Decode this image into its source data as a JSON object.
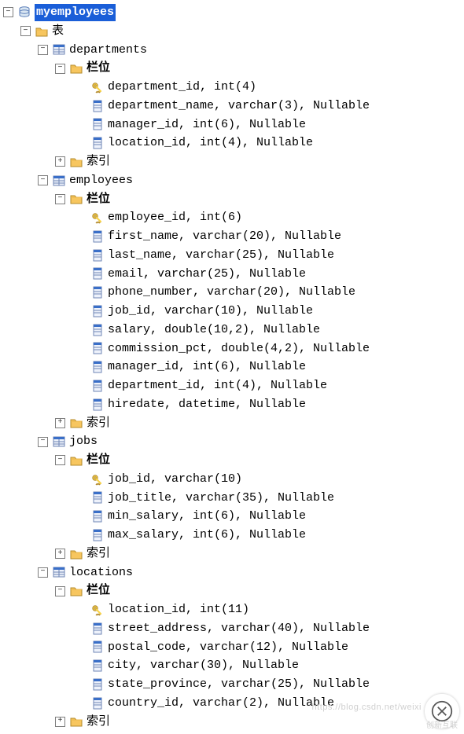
{
  "db": {
    "name": "myemployees"
  },
  "nodes": {
    "tables_label": "表",
    "columns_label": "栏位",
    "indexes_label": "索引"
  },
  "tables": {
    "departments": {
      "name": "departments",
      "columns": [
        {
          "pk": true,
          "text": "department_id, int(4)"
        },
        {
          "pk": false,
          "text": "department_name, varchar(3), Nullable"
        },
        {
          "pk": false,
          "text": "manager_id, int(6), Nullable"
        },
        {
          "pk": false,
          "text": "location_id, int(4), Nullable"
        }
      ]
    },
    "employees": {
      "name": "employees",
      "columns": [
        {
          "pk": true,
          "text": "employee_id, int(6)"
        },
        {
          "pk": false,
          "text": "first_name, varchar(20), Nullable"
        },
        {
          "pk": false,
          "text": "last_name, varchar(25), Nullable"
        },
        {
          "pk": false,
          "text": "email, varchar(25), Nullable"
        },
        {
          "pk": false,
          "text": "phone_number, varchar(20), Nullable"
        },
        {
          "pk": false,
          "text": "job_id, varchar(10), Nullable"
        },
        {
          "pk": false,
          "text": "salary, double(10,2), Nullable"
        },
        {
          "pk": false,
          "text": "commission_pct, double(4,2), Nullable"
        },
        {
          "pk": false,
          "text": "manager_id, int(6), Nullable"
        },
        {
          "pk": false,
          "text": "department_id, int(4), Nullable"
        },
        {
          "pk": false,
          "text": "hiredate, datetime, Nullable"
        }
      ]
    },
    "jobs": {
      "name": "jobs",
      "columns": [
        {
          "pk": true,
          "text": "job_id, varchar(10)"
        },
        {
          "pk": false,
          "text": "job_title, varchar(35), Nullable"
        },
        {
          "pk": false,
          "text": "min_salary, int(6), Nullable"
        },
        {
          "pk": false,
          "text": "max_salary, int(6), Nullable"
        }
      ]
    },
    "locations": {
      "name": "locations",
      "columns": [
        {
          "pk": true,
          "text": "location_id, int(11)"
        },
        {
          "pk": false,
          "text": "street_address, varchar(40), Nullable"
        },
        {
          "pk": false,
          "text": "postal_code, varchar(12), Nullable"
        },
        {
          "pk": false,
          "text": "city, varchar(30), Nullable"
        },
        {
          "pk": false,
          "text": "state_province, varchar(25), Nullable"
        },
        {
          "pk": false,
          "text": "country_id, varchar(2), Nullable"
        }
      ]
    }
  },
  "watermark": {
    "brand": "创新互联",
    "url": "https://blog.csdn.net/weixi"
  }
}
